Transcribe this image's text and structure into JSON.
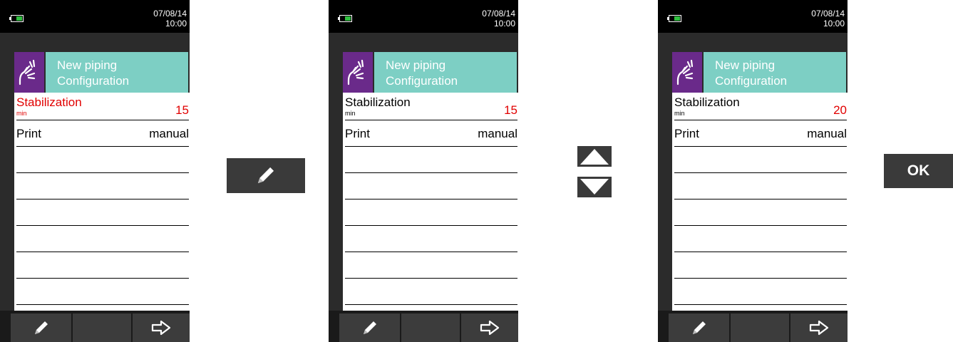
{
  "steps": [
    {
      "datetime": {
        "date": "07/08/14",
        "time": "10:00"
      },
      "header": {
        "line1": "New piping",
        "line2": "Configuration"
      },
      "stabilization": {
        "label": "Stabilization",
        "unit": "min",
        "value": "15",
        "selected": true,
        "value_red": true
      },
      "print": {
        "label": "Print",
        "value": "manual"
      }
    },
    {
      "datetime": {
        "date": "07/08/14",
        "time": "10:00"
      },
      "header": {
        "line1": "New piping",
        "line2": "Configuration"
      },
      "stabilization": {
        "label": "Stabilization",
        "unit": "min",
        "value": "15",
        "selected": false,
        "value_red": true
      },
      "print": {
        "label": "Print",
        "value": "manual"
      }
    },
    {
      "datetime": {
        "date": "07/08/14",
        "time": "10:00"
      },
      "header": {
        "line1": "New piping",
        "line2": "Configuration"
      },
      "stabilization": {
        "label": "Stabilization",
        "unit": "min",
        "value": "20",
        "selected": false,
        "value_red": true
      },
      "print": {
        "label": "Print",
        "value": "manual"
      }
    }
  ],
  "footer": {
    "left_icon": "pencil-icon",
    "middle": "",
    "right_icon": "arrow-right-icon"
  },
  "keys": {
    "edit": {
      "icon": "pencil-icon"
    },
    "up": {
      "icon": "triangle-up-icon"
    },
    "down": {
      "icon": "triangle-down-icon"
    },
    "ok": {
      "label": "OK"
    }
  },
  "colors": {
    "accent_teal": "#7dcfc4",
    "icon_purple": "#6a2a8a",
    "selection_red": "#e10000",
    "battery_green": "#2fbf3f"
  }
}
